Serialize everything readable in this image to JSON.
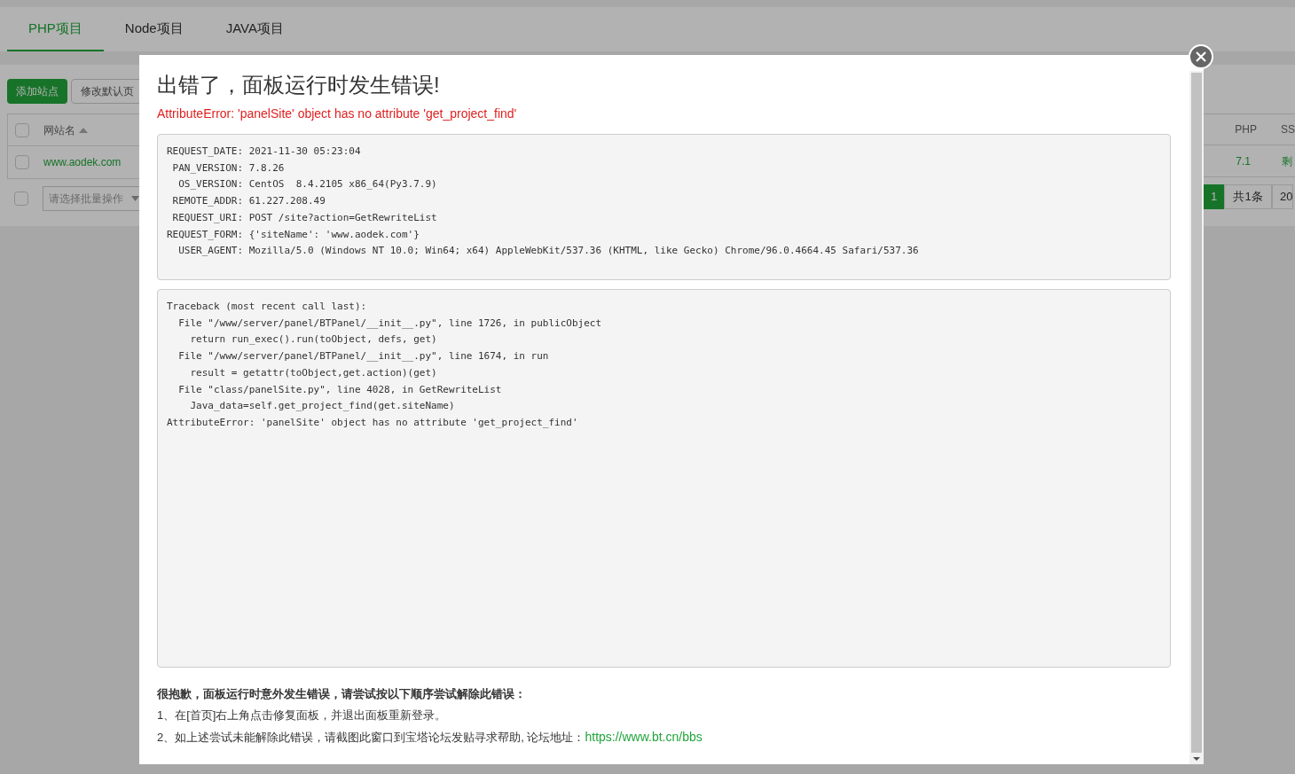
{
  "tabs": [
    {
      "label": "PHP项目",
      "selected": true
    },
    {
      "label": "Node项目",
      "selected": false
    },
    {
      "label": "JAVA项目",
      "selected": false
    }
  ],
  "toolbar": {
    "buttons": [
      {
        "label": "添加站点",
        "kind": "primary"
      },
      {
        "label": "修改默认页",
        "kind": "default"
      }
    ]
  },
  "table": {
    "select_all_checked": false,
    "columns": [
      {
        "label": "网站名",
        "sorted": true
      },
      {
        "label": "PHP"
      },
      {
        "label": "SS"
      }
    ],
    "rows": [
      {
        "checked": false,
        "cells": [
          "www.aodek.com",
          "7.1",
          "剩"
        ]
      }
    ]
  },
  "batch": {
    "checked": false,
    "placeholder": "请选择批量操作"
  },
  "pagination": {
    "current": "1",
    "total": "共1条",
    "page_size": "20"
  },
  "dialog": {
    "title": "出错了，面板运行时发生错误!",
    "error": "AttributeError: 'panelSite' object has no attribute 'get_project_find'",
    "info_lines": [
      "REQUEST_DATE: 2021-11-30 05:23:04",
      " PAN_VERSION: 7.8.26",
      "  OS_VERSION: CentOS  8.4.2105 x86_64(Py3.7.9)",
      " REMOTE_ADDR: 61.227.208.49",
      " REQUEST_URI: POST /site?action=GetRewriteList",
      "REQUEST_FORM: {'siteName': 'www.aodek.com'}",
      "  USER_AGENT: Mozilla/5.0 (Windows NT 10.0; Win64; x64) AppleWebKit/537.36 (KHTML, like Gecko) Chrome/96.0.4664.45 Safari/537.36"
    ],
    "traceback_lines": [
      "Traceback (most recent call last):",
      "  File \"/www/server/panel/BTPanel/__init__.py\", line 1726, in publicObject",
      "    return run_exec().run(toObject, defs, get)",
      "  File \"/www/server/panel/BTPanel/__init__.py\", line 1674, in run",
      "    result = getattr(toObject,get.action)(get)",
      "  File \"class/panelSite.py\", line 4028, in GetRewriteList",
      "    Java_data=self.get_project_find(get.siteName)",
      "AttributeError: 'panelSite' object has no attribute 'get_project_find'"
    ],
    "help": {
      "heading": "很抱歉，面板运行时意外发生错误，请尝试按以下顺序尝试解除此错误：",
      "steps": [
        {
          "text": "1、在[首页]右上角点击修复面板，并退出面板重新登录。"
        },
        {
          "text": "2、如上述尝试未能解除此错误，请截图此窗口到宝塔论坛发贴寻求帮助, 论坛地址：",
          "link": "https://www.bt.cn/bbs"
        }
      ]
    }
  }
}
